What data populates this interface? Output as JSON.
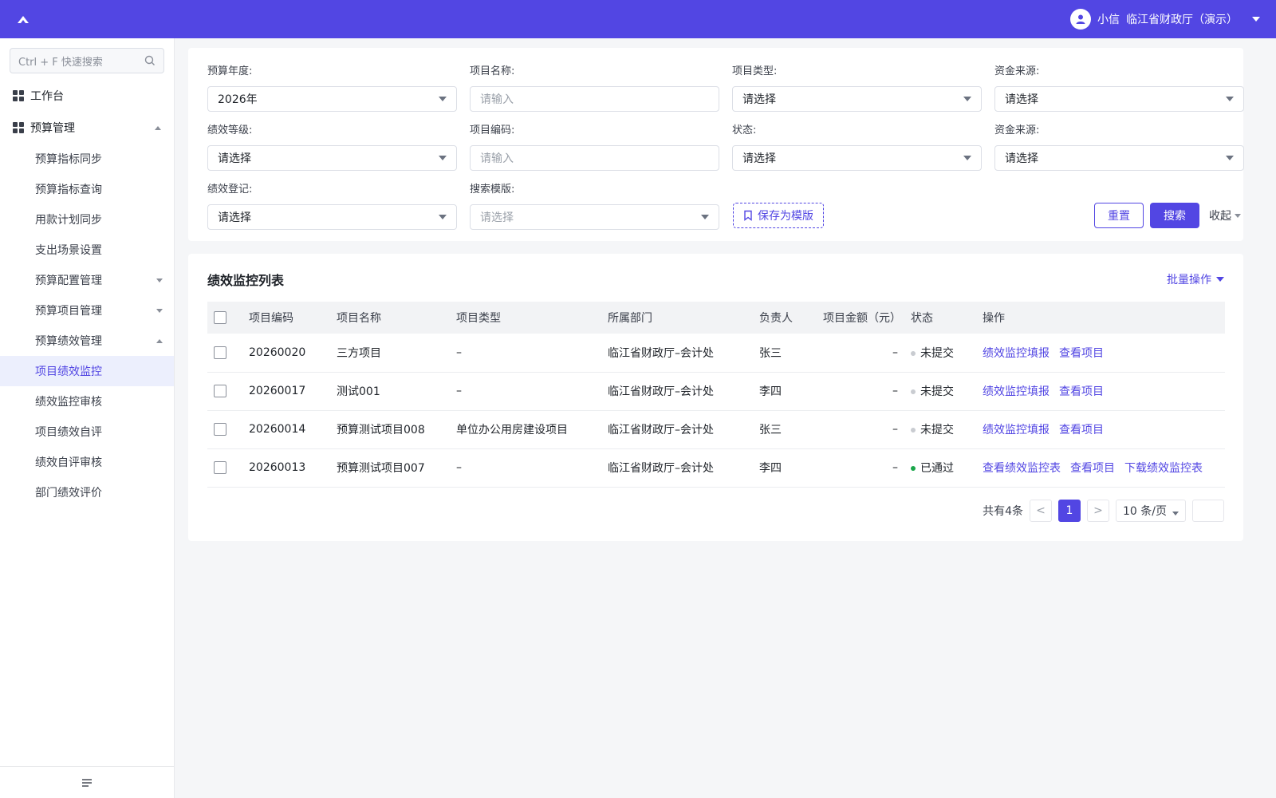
{
  "header": {
    "user_name": "小信",
    "org": "临江省财政厅（演示）"
  },
  "sidebar": {
    "search_placeholder": "Ctrl + F 快速搜索",
    "workbench": "工作台",
    "budget_mgmt": "预算管理",
    "items": [
      {
        "label": "预算指标同步"
      },
      {
        "label": "预算指标查询"
      },
      {
        "label": "用款计划同步"
      },
      {
        "label": "支出场景设置"
      },
      {
        "label": "预算配置管理"
      },
      {
        "label": "预算项目管理"
      },
      {
        "label": "预算绩效管理"
      },
      {
        "label": "项目绩效监控"
      },
      {
        "label": "绩效监控审核"
      },
      {
        "label": "项目绩效自评"
      },
      {
        "label": "绩效自评审核"
      },
      {
        "label": "部门绩效评价"
      }
    ],
    "active_item": "项目绩效监控"
  },
  "filters": {
    "budget_year": {
      "label": "预算年度:",
      "value": "2026年"
    },
    "project_name": {
      "label": "项目名称:",
      "placeholder": "请输入"
    },
    "project_type": {
      "label": "项目类型:",
      "value": "请选择"
    },
    "fund_source_1": {
      "label": "资金来源:",
      "value": "请选择"
    },
    "perf_level": {
      "label": "绩效等级:",
      "value": "请选择"
    },
    "project_code": {
      "label": "项目编码:",
      "placeholder": "请输入"
    },
    "status": {
      "label": "状态:",
      "value": "请选择"
    },
    "fund_source_2": {
      "label": "资金来源:",
      "value": "请选择"
    },
    "perf_register": {
      "label": "绩效登记:",
      "value": "请选择"
    },
    "search_template": {
      "label": "搜索模版:",
      "placeholder": "请选择"
    },
    "save_template": "保存为模版",
    "reset": "重置",
    "search": "搜索",
    "collapse": "收起"
  },
  "list": {
    "title": "绩效监控列表",
    "batch": "批量操作",
    "columns": [
      "项目编码",
      "项目名称",
      "项目类型",
      "所属部门",
      "负责人",
      "项目金额（元）",
      "状态",
      "操作"
    ],
    "rows": [
      {
        "code": "20260020",
        "name": "三方项目",
        "type": "–",
        "dept": "临江省财政厅–会计处",
        "owner": "张三",
        "amount": "–",
        "status": "未提交",
        "status_color": "#c9ccd1",
        "ops": [
          "绩效监控填报",
          "查看项目"
        ]
      },
      {
        "code": "20260017",
        "name": "测试001",
        "type": "–",
        "dept": "临江省财政厅–会计处",
        "owner": "李四",
        "amount": "–",
        "status": "未提交",
        "status_color": "#c9ccd1",
        "ops": [
          "绩效监控填报",
          "查看项目"
        ]
      },
      {
        "code": "20260014",
        "name": "预算测试项目008",
        "type": "单位办公用房建设项目",
        "dept": "临江省财政厅–会计处",
        "owner": "张三",
        "amount": "–",
        "status": "未提交",
        "status_color": "#c9ccd1",
        "ops": [
          "绩效监控填报",
          "查看项目"
        ]
      },
      {
        "code": "20260013",
        "name": "预算测试项目007",
        "type": "–",
        "dept": "临江省财政厅–会计处",
        "owner": "李四",
        "amount": "–",
        "status": "已通过",
        "status_color": "#1aa64a",
        "ops": [
          "查看绩效监控表",
          "查看项目",
          "下载绩效监控表"
        ]
      }
    ]
  },
  "pager": {
    "total": "共有4条",
    "prev": "<",
    "current": "1",
    "next": ">",
    "page_size": "10 条/页"
  },
  "colors": {
    "brand": "#5246e3"
  }
}
